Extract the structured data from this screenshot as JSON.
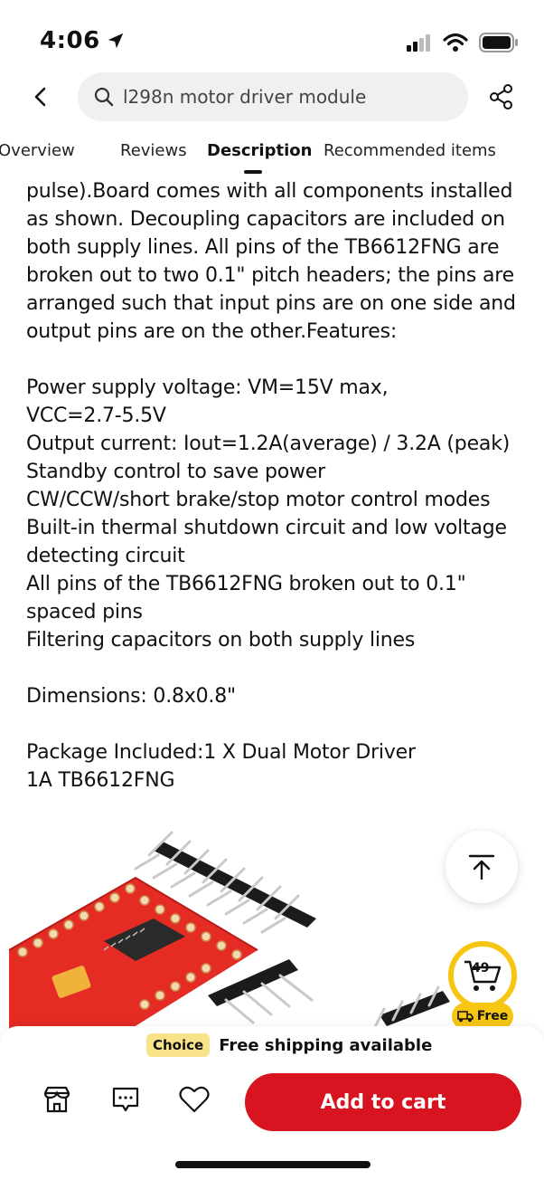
{
  "status_bar": {
    "time": "4:06"
  },
  "search": {
    "query": "l298n motor driver module"
  },
  "tabs": [
    {
      "label": "Overview"
    },
    {
      "label": "Reviews"
    },
    {
      "label": "Description"
    },
    {
      "label": "Recommended items"
    }
  ],
  "description": {
    "text": "pulse).Board comes with all components installed\nas shown. Decoupling capacitors are included on\nboth supply lines. All pins of the TB6612FNG are\nbroken out to two 0.1\" pitch headers; the pins are\narranged such that input pins are on one side and\noutput pins are on the other.Features:\n\nPower supply voltage: VM=15V max,\nVCC=2.7-5.5V\nOutput current: Iout=1.2A(average) / 3.2A (peak)\nStandby control to save power\nCW/CCW/short brake/stop motor control modes\nBuilt-in thermal shutdown circuit and low voltage\ndetecting circuit\nAll pins of the TB6612FNG broken out to 0.1\"\nspaced pins\nFiltering capacitors on both supply lines\n\nDimensions: 0.8x0.8\"\n\nPackage Included:1 X Dual Motor Driver\n1A TB6612FNG"
  },
  "floating": {
    "cart_count": "49",
    "free_label": "Free"
  },
  "bottom_bar": {
    "choice_badge": "Choice",
    "shipping_text": "Free shipping available",
    "add_to_cart_label": "Add to cart"
  },
  "colors": {
    "accent_red": "#d7141f",
    "badge_yellow": "#f7c613",
    "choice_bg": "#f8e28a"
  }
}
